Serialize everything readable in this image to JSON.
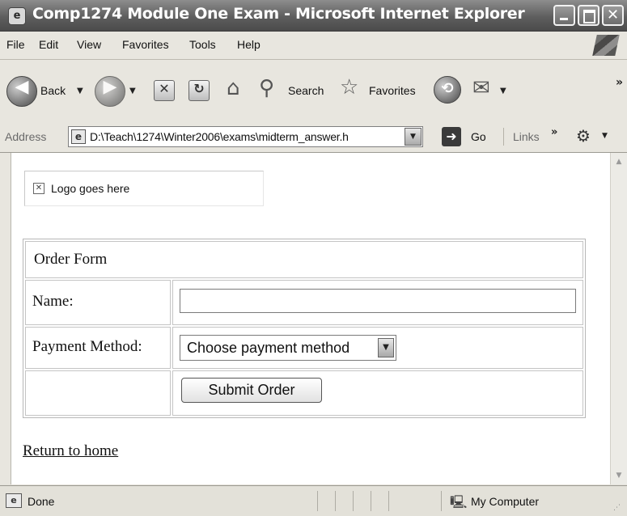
{
  "window": {
    "title": "Comp1274 Module One Exam - Microsoft Internet Explorer"
  },
  "menu": {
    "items": [
      "File",
      "Edit",
      "View",
      "Favorites",
      "Tools",
      "Help"
    ]
  },
  "toolbar": {
    "back_label": "Back",
    "search_label": "Search",
    "favorites_label": "Favorites"
  },
  "address": {
    "label": "Address",
    "url": "D:\\Teach\\1274\\Winter2006\\exams\\midterm_answer.h",
    "go_label": "Go",
    "links_label": "Links"
  },
  "page": {
    "logo_alt": "Logo goes here",
    "form": {
      "heading": "Order Form",
      "name_label": "Name:",
      "name_value": "",
      "payment_label": "Payment Method:",
      "payment_selected": "Choose payment method",
      "submit_label": "Submit Order"
    },
    "return_link": "Return to home"
  },
  "status": {
    "text": "Done",
    "zone": "My Computer"
  }
}
